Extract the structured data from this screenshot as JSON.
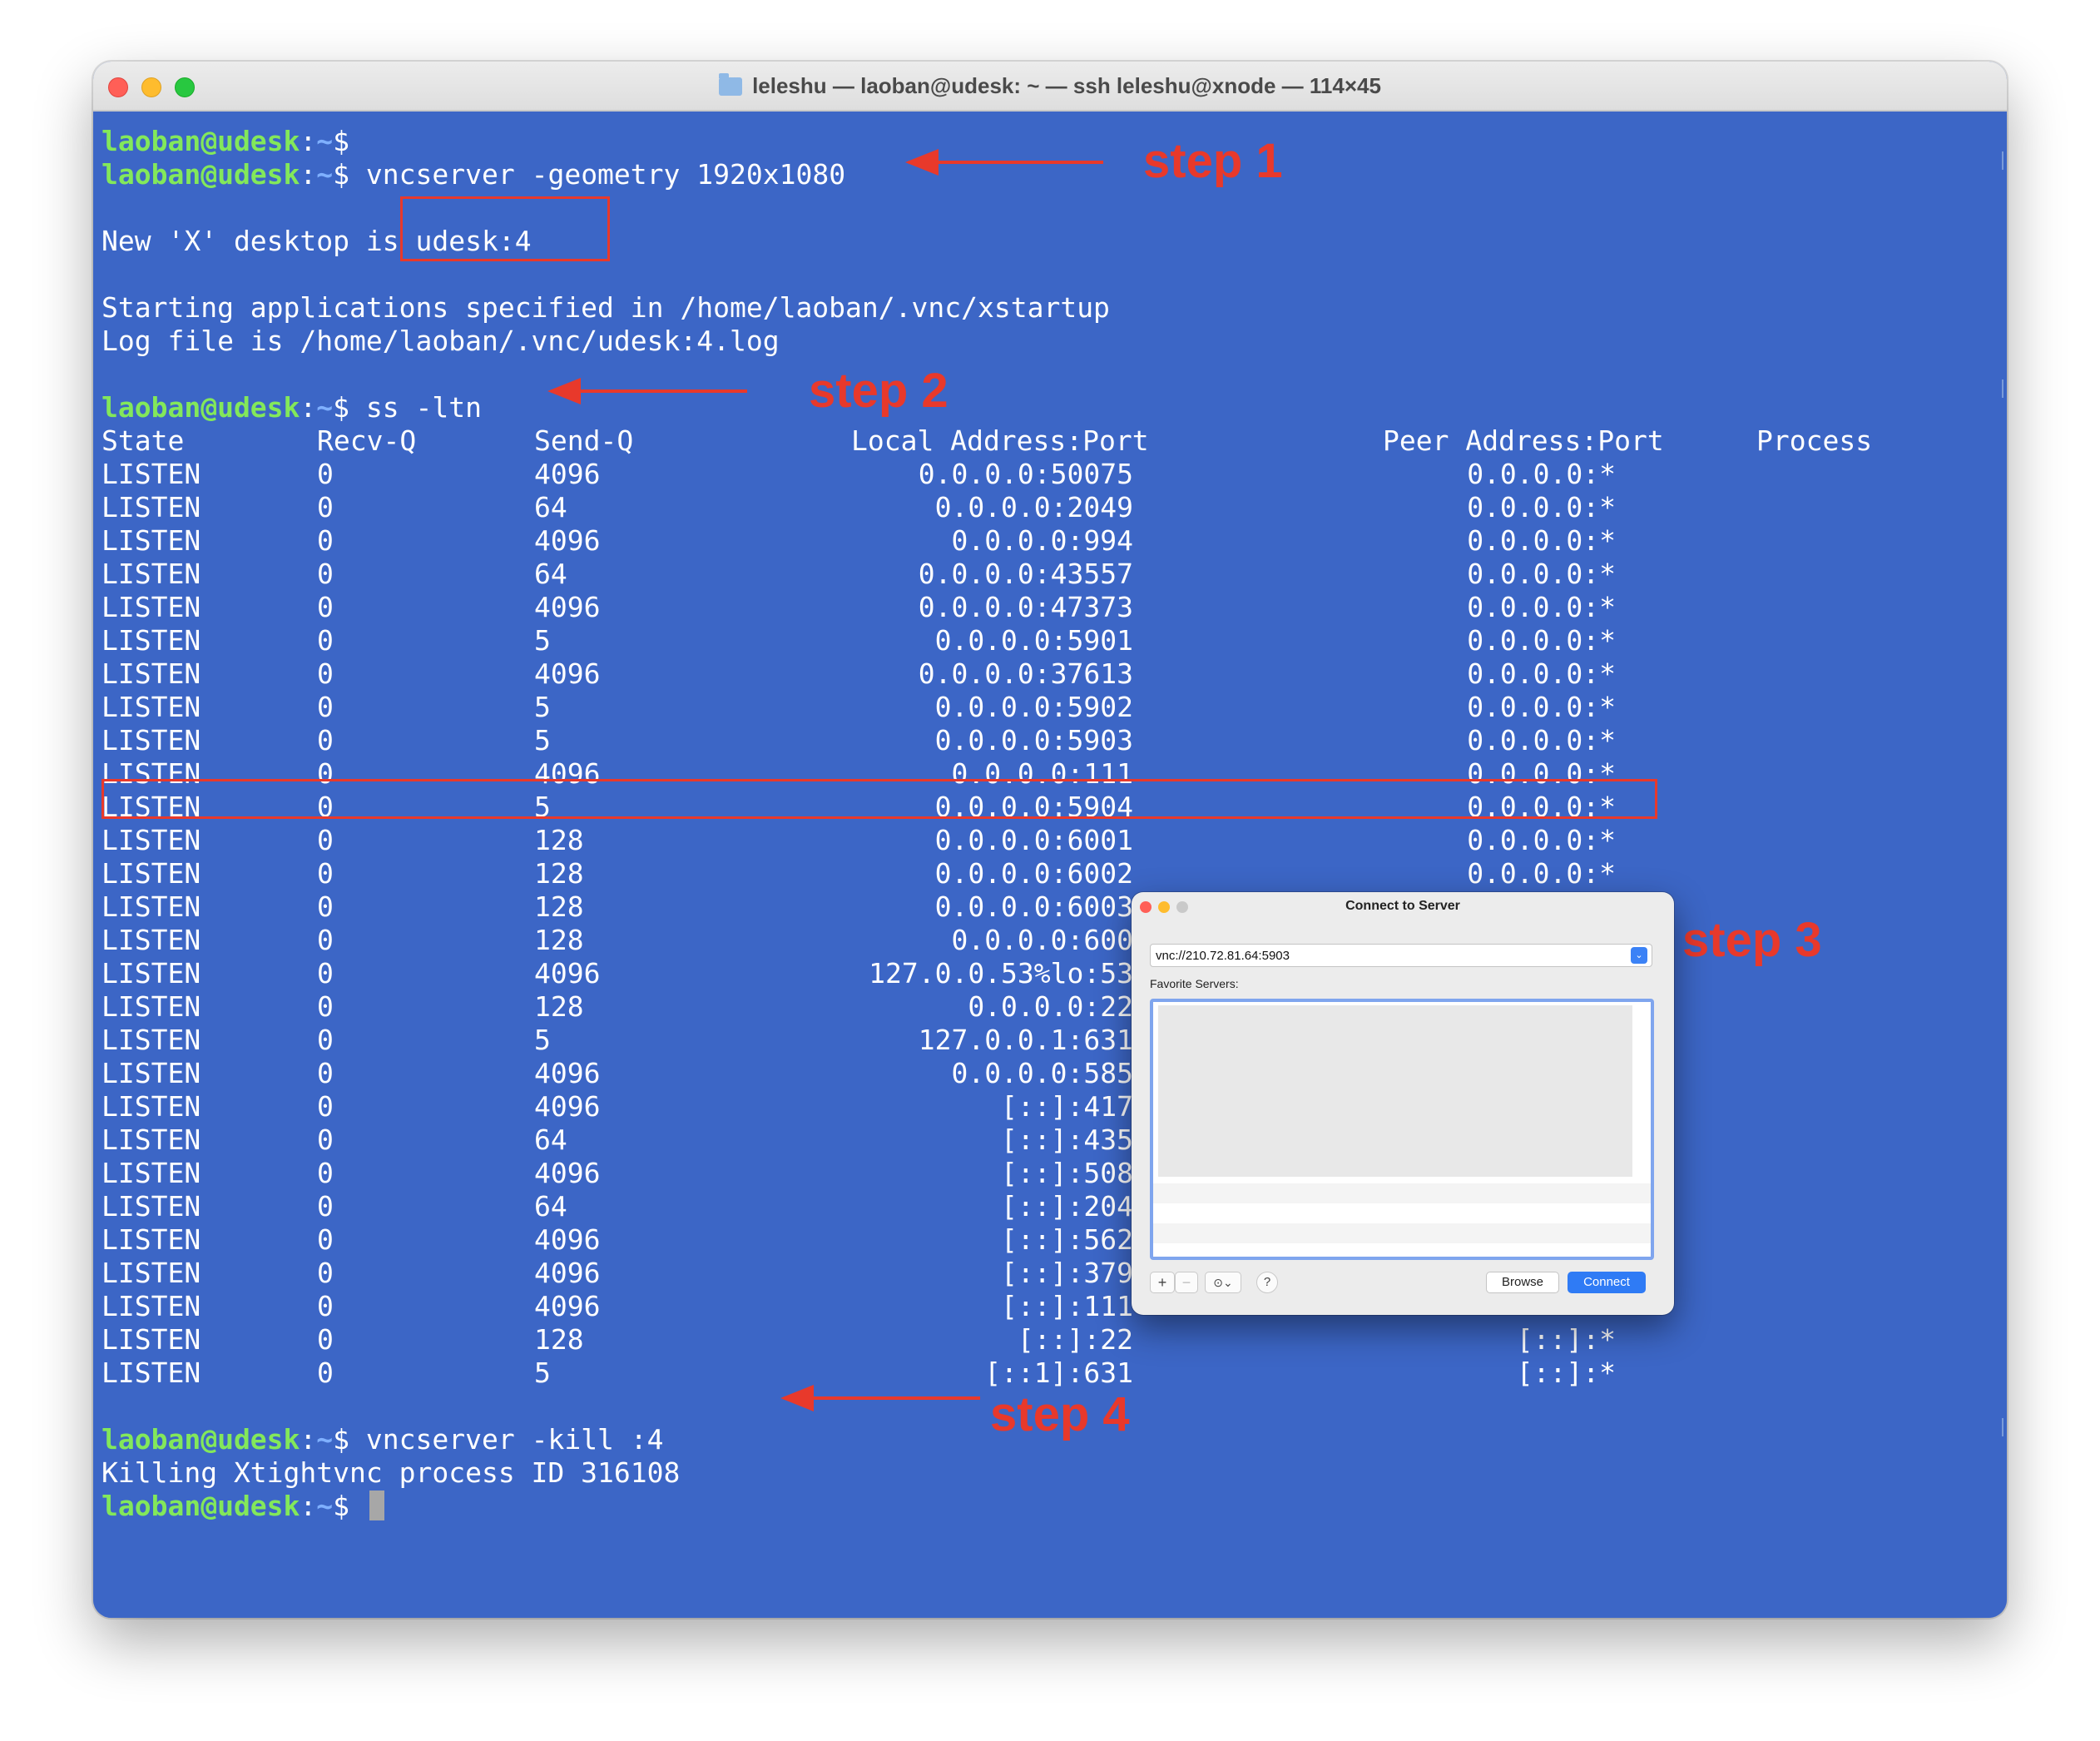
{
  "window": {
    "title": "leleshu — laoban@udesk: ~ — ssh leleshu@xnode — 114×45"
  },
  "prompt": {
    "user": "laoban@udesk",
    "colon": ":",
    "tilde": "~",
    "dollar": "$"
  },
  "terminal": {
    "cmd1": " vncserver -geometry 1920x1080",
    "desktop_prefix": "New 'X' desktop is ",
    "desktop_name": "udesk:4",
    "start_line": "Starting applications specified in /home/laoban/.vnc/xstartup",
    "log_line": "Log file is /home/laoban/.vnc/udesk:4.log",
    "cmd2": " ss -ltn",
    "cmd4": " vncserver -kill :4",
    "kill_line": "Killing Xtightvnc process ID 316108"
  },
  "ss_table": {
    "headers": [
      "State",
      "Recv-Q",
      "Send-Q",
      "Local Address:Port",
      "Peer Address:Port",
      "Process"
    ],
    "rows": [
      [
        "LISTEN",
        "0",
        "4096",
        "0.0.0.0:50075",
        "0.0.0.0:*"
      ],
      [
        "LISTEN",
        "0",
        "64",
        "0.0.0.0:2049",
        "0.0.0.0:*"
      ],
      [
        "LISTEN",
        "0",
        "4096",
        "0.0.0.0:994",
        "0.0.0.0:*"
      ],
      [
        "LISTEN",
        "0",
        "64",
        "0.0.0.0:43557",
        "0.0.0.0:*"
      ],
      [
        "LISTEN",
        "0",
        "4096",
        "0.0.0.0:47373",
        "0.0.0.0:*"
      ],
      [
        "LISTEN",
        "0",
        "5",
        "0.0.0.0:5901",
        "0.0.0.0:*"
      ],
      [
        "LISTEN",
        "0",
        "4096",
        "0.0.0.0:37613",
        "0.0.0.0:*"
      ],
      [
        "LISTEN",
        "0",
        "5",
        "0.0.0.0:5902",
        "0.0.0.0:*"
      ],
      [
        "LISTEN",
        "0",
        "5",
        "0.0.0.0:5903",
        "0.0.0.0:*"
      ],
      [
        "LISTEN",
        "0",
        "4096",
        "0.0.0.0:111",
        "0.0.0.0:*"
      ],
      [
        "LISTEN",
        "0",
        "5",
        "0.0.0.0:5904",
        "0.0.0.0:*"
      ],
      [
        "LISTEN",
        "0",
        "128",
        "0.0.0.0:6001",
        "0.0.0.0:*"
      ],
      [
        "LISTEN",
        "0",
        "128",
        "0.0.0.0:6002",
        "0.0.0.0:*"
      ],
      [
        "LISTEN",
        "0",
        "128",
        "0.0.0.0:6003",
        ""
      ],
      [
        "LISTEN",
        "0",
        "128",
        "0.0.0.0:600",
        ""
      ],
      [
        "LISTEN",
        "0",
        "4096",
        "127.0.0.53%lo:53",
        ""
      ],
      [
        "LISTEN",
        "0",
        "128",
        "0.0.0.0:22",
        ""
      ],
      [
        "LISTEN",
        "0",
        "5",
        "127.0.0.1:631",
        ""
      ],
      [
        "LISTEN",
        "0",
        "4096",
        "0.0.0.0:585",
        ""
      ],
      [
        "LISTEN",
        "0",
        "4096",
        "[::]:417",
        ""
      ],
      [
        "LISTEN",
        "0",
        "64",
        "[::]:435",
        ""
      ],
      [
        "LISTEN",
        "0",
        "4096",
        "[::]:508",
        ""
      ],
      [
        "LISTEN",
        "0",
        "64",
        "[::]:204",
        ""
      ],
      [
        "LISTEN",
        "0",
        "4096",
        "[::]:562",
        ""
      ],
      [
        "LISTEN",
        "0",
        "4096",
        "[::]:379",
        ""
      ],
      [
        "LISTEN",
        "0",
        "4096",
        "[::]:111",
        ""
      ],
      [
        "LISTEN",
        "0",
        "128",
        "[::]:22",
        "[::]:*"
      ],
      [
        "LISTEN",
        "0",
        "5",
        "[::1]:631",
        "[::]:*"
      ]
    ]
  },
  "annotations": {
    "step1": "step 1",
    "step2": "step 2",
    "step3": "step 3",
    "step4": "step 4"
  },
  "dialog": {
    "title": "Connect to Server",
    "address": "vnc://210.72.81.64:5903",
    "favorites_label": "Favorite Servers:",
    "add": "+",
    "remove": "−",
    "more": "⊙⌄",
    "help": "?",
    "browse": "Browse",
    "connect": "Connect"
  },
  "colors": {
    "terminal_bg": "#3c66c6",
    "prompt_user": "#83e85a",
    "annotation": "#e8392b",
    "connect": "#2f7bf5"
  }
}
